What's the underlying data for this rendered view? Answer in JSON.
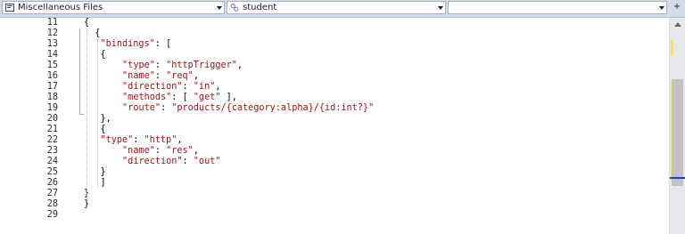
{
  "navbar": {
    "project_combo": "Miscellaneous Files",
    "scope_combo": "student",
    "member_combo": "",
    "split_glyph": "+"
  },
  "editor": {
    "lines": [
      {
        "num": "11",
        "indent": 0,
        "tokens": [
          {
            "t": "{",
            "k": "p"
          }
        ]
      },
      {
        "num": "12",
        "indent": 2,
        "tokens": [
          {
            "t": "{",
            "k": "p"
          }
        ]
      },
      {
        "num": "13",
        "indent": 3,
        "tokens": [
          {
            "t": "\"bindings\"",
            "k": "s"
          },
          {
            "t": ": [",
            "k": "p"
          }
        ]
      },
      {
        "num": "14",
        "indent": 3,
        "tokens": [
          {
            "t": "{",
            "k": "p"
          }
        ]
      },
      {
        "num": "15",
        "indent": 7,
        "tokens": [
          {
            "t": "\"type\"",
            "k": "s"
          },
          {
            "t": ": ",
            "k": "p"
          },
          {
            "t": "\"httpTrigger\"",
            "k": "s"
          },
          {
            "t": ",",
            "k": "p"
          }
        ]
      },
      {
        "num": "16",
        "indent": 7,
        "tokens": [
          {
            "t": "\"name\"",
            "k": "s"
          },
          {
            "t": ": ",
            "k": "p"
          },
          {
            "t": "\"req\"",
            "k": "s"
          },
          {
            "t": ",",
            "k": "p"
          }
        ]
      },
      {
        "num": "17",
        "indent": 7,
        "tokens": [
          {
            "t": "\"direction\"",
            "k": "s"
          },
          {
            "t": ": ",
            "k": "p"
          },
          {
            "t": "\"in\"",
            "k": "s"
          },
          {
            "t": ",",
            "k": "p"
          }
        ]
      },
      {
        "num": "18",
        "indent": 7,
        "tokens": [
          {
            "t": "\"methods\"",
            "k": "s"
          },
          {
            "t": ": [ ",
            "k": "p"
          },
          {
            "t": "\"get\"",
            "k": "s"
          },
          {
            "t": " ],",
            "k": "p"
          }
        ]
      },
      {
        "num": "19",
        "indent": 7,
        "tokens": [
          {
            "t": "\"route\"",
            "k": "s"
          },
          {
            "t": ": ",
            "k": "p"
          },
          {
            "t": "\"products/{category:alpha}/{id:int?}\"",
            "k": "s"
          }
        ]
      },
      {
        "num": "20",
        "indent": 3,
        "tokens": [
          {
            "t": "},",
            "k": "p"
          }
        ]
      },
      {
        "num": "21",
        "indent": 3,
        "tokens": [
          {
            "t": "{",
            "k": "p"
          }
        ]
      },
      {
        "num": "22",
        "indent": 3,
        "tokens": [
          {
            "t": "\"type\"",
            "k": "s"
          },
          {
            "t": ": ",
            "k": "p"
          },
          {
            "t": "\"http\"",
            "k": "s"
          },
          {
            "t": ",",
            "k": "p"
          }
        ]
      },
      {
        "num": "23",
        "indent": 7,
        "tokens": [
          {
            "t": "\"name\"",
            "k": "s"
          },
          {
            "t": ": ",
            "k": "p"
          },
          {
            "t": "\"res\"",
            "k": "s"
          },
          {
            "t": ",",
            "k": "p"
          }
        ]
      },
      {
        "num": "24",
        "indent": 7,
        "tokens": [
          {
            "t": "\"direction\"",
            "k": "s"
          },
          {
            "t": ": ",
            "k": "p"
          },
          {
            "t": "\"out\"",
            "k": "s"
          }
        ]
      },
      {
        "num": "25",
        "indent": 3,
        "tokens": [
          {
            "t": "}",
            "k": "p"
          }
        ]
      },
      {
        "num": "26",
        "indent": 3,
        "tokens": [
          {
            "t": "]",
            "k": "p"
          }
        ]
      },
      {
        "num": "27",
        "indent": 0,
        "tokens": [
          {
            "t": "}",
            "k": "p"
          }
        ]
      },
      {
        "num": "28",
        "indent": 0,
        "tokens": [
          {
            "t": "}",
            "k": "p"
          }
        ]
      },
      {
        "num": "29",
        "indent": 0,
        "tokens": []
      }
    ]
  },
  "colors": {
    "string": "#a31515",
    "punctuation": "#000000",
    "line_number": "#2b2b2b",
    "change_bar": "#f2e46a",
    "caret_marker": "#1c3fd1"
  }
}
